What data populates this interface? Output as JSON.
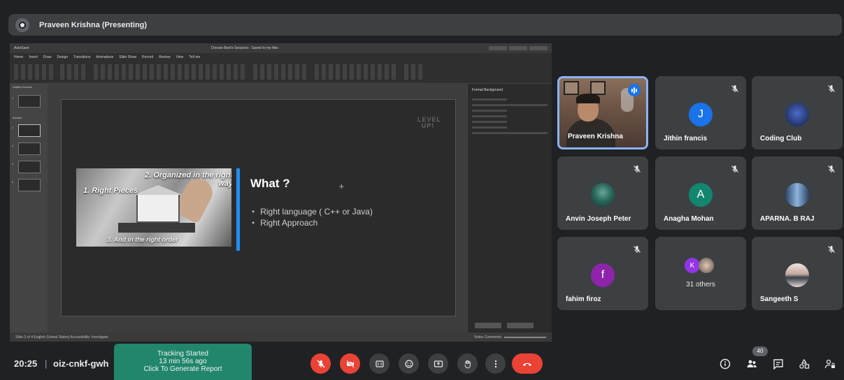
{
  "presenter": {
    "name": "Praveen Krishna (Presenting)"
  },
  "ppt": {
    "autosave_label": "AutoSave",
    "doc_title": "Choose Best's Sessions - Saved to my files",
    "menu": [
      "Home",
      "Insert",
      "Draw",
      "Design",
      "Transitions",
      "Animations",
      "Slide Show",
      "Record",
      "Review",
      "View",
      "Tell me"
    ],
    "status_left": "Slide 2 of 4   English (United States)   Accessibility: Investigate",
    "status_right": "Notes   Comments",
    "format_pane_title": "Format Background",
    "thumb_header": "Untitled Section",
    "thumb_section": "Section",
    "thumb_numbers": [
      "1",
      "2",
      "3",
      "4",
      "5"
    ]
  },
  "slide": {
    "logo": "LEVEL UP!",
    "caption1": "1. Right Pieces",
    "caption2": "2. Organized in the right way",
    "caption3": "3. And in the right order",
    "heading": "What ?",
    "bullets": [
      "Right language ( C++ or Java)",
      "Right Approach"
    ]
  },
  "participants": [
    {
      "name": "Praveen Krishna",
      "type": "video",
      "speaking": true
    },
    {
      "name": "Jithin francis",
      "initial": "J",
      "color": "#1a73e8",
      "muted": true
    },
    {
      "name": "Coding Club",
      "initial": "",
      "color": "#24346b",
      "muted": true
    },
    {
      "name": "Anvin Joseph Peter",
      "initial": "",
      "color": "#2b6b5e",
      "muted": true
    },
    {
      "name": "Anagha Mohan",
      "initial": "A",
      "color": "#12866e",
      "muted": true
    },
    {
      "name": "APARNA. B RAJ",
      "initial": "",
      "color": "#3b5f8f",
      "muted": true
    },
    {
      "name": "fahim firoz",
      "initial": "f",
      "color": "#8e24aa",
      "muted": true
    },
    {
      "name": "31 others",
      "initial": "K",
      "color": "#9334e6",
      "muted": false
    },
    {
      "name": "Sangeeth S",
      "initial": "",
      "color": "#c7a9a0",
      "muted": true
    }
  ],
  "bottom": {
    "time": "20:25",
    "separator": "|",
    "meeting_code": "oiz-cnkf-gwh",
    "tracking_line1": "Tracking Started",
    "tracking_line2": "13 min 56s ago",
    "tracking_line3": "Click To Generate Report",
    "participant_count": "40"
  }
}
